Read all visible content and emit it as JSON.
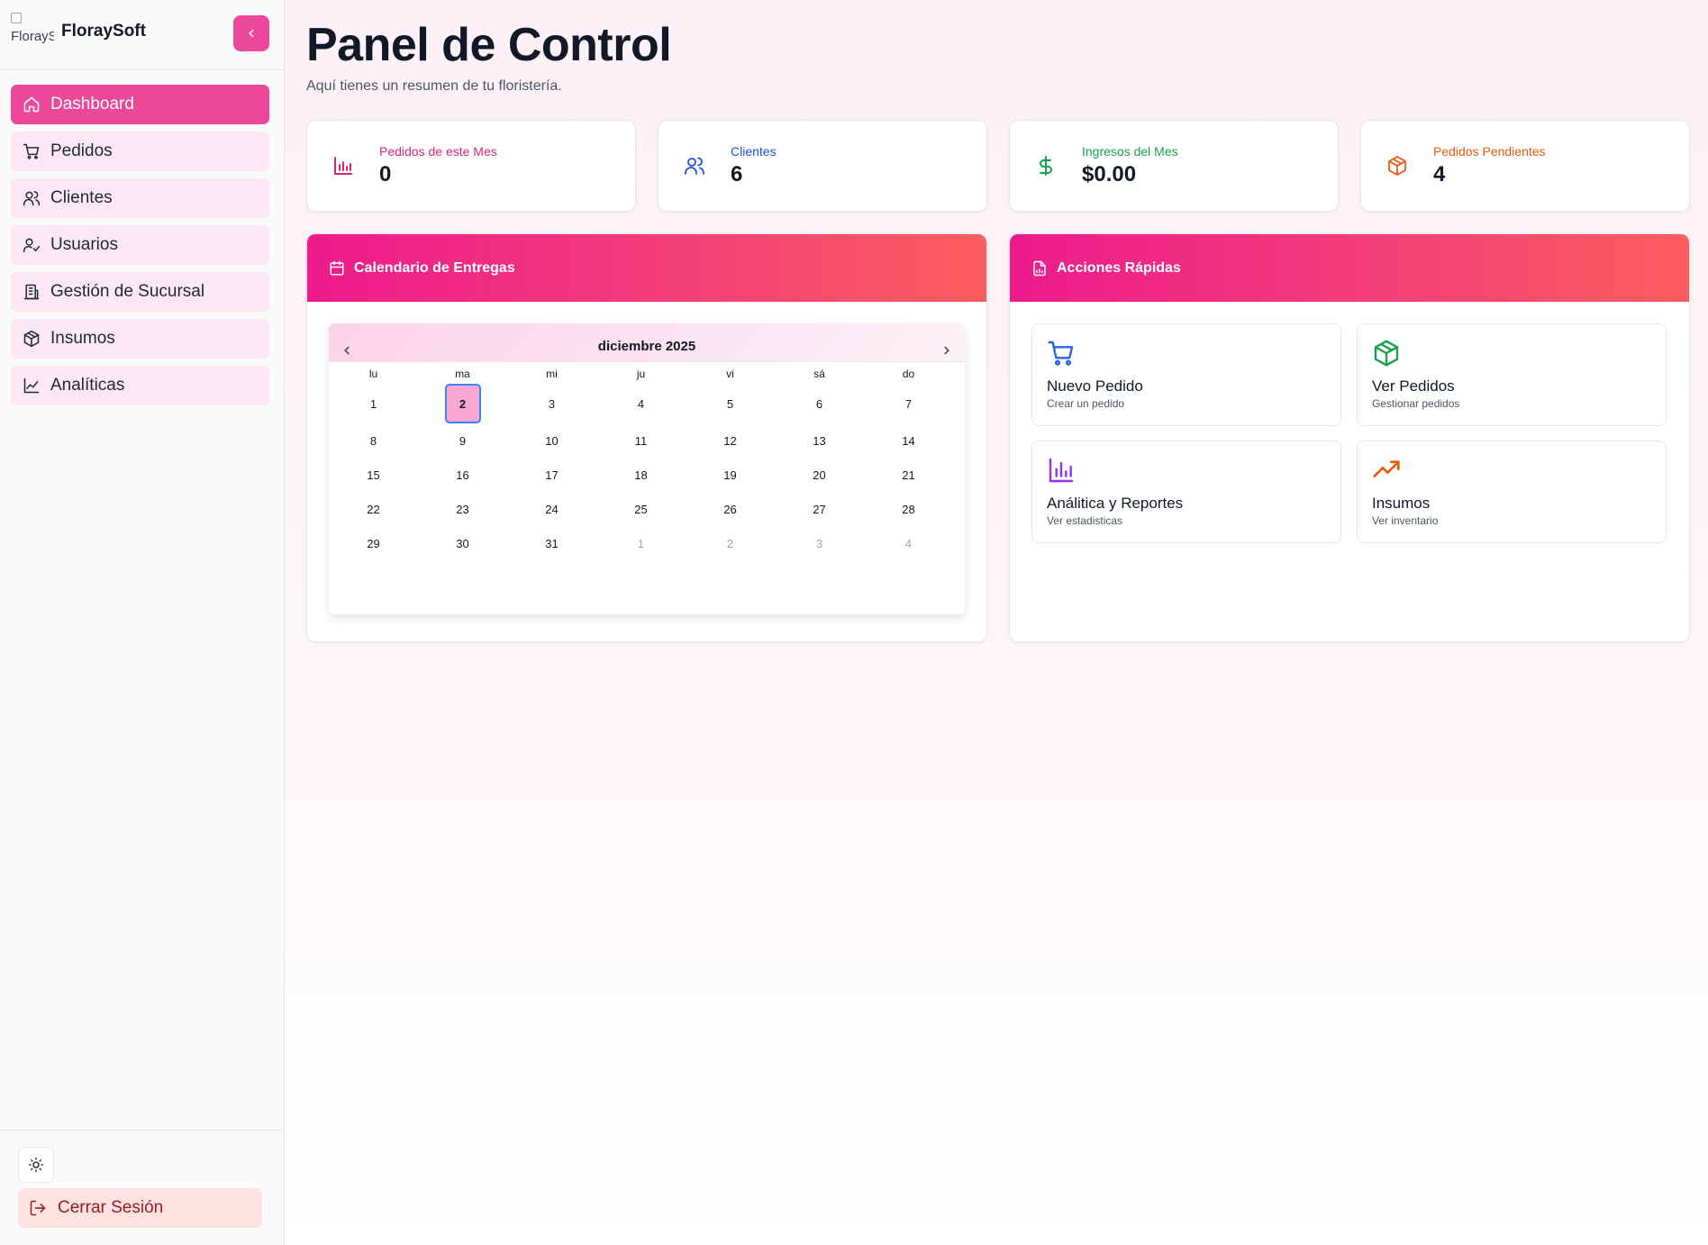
{
  "brand": {
    "logo_alt": "FloraySoft",
    "name": "FloraySoft"
  },
  "sidebar": {
    "items": [
      {
        "label": "Dashboard",
        "icon": "home-icon",
        "active": true
      },
      {
        "label": "Pedidos",
        "icon": "cart-icon"
      },
      {
        "label": "Clientes",
        "icon": "users-icon"
      },
      {
        "label": "Usuarios",
        "icon": "user-check-icon"
      },
      {
        "label": "Gestión de Sucursal",
        "icon": "building-icon"
      },
      {
        "label": "Insumos",
        "icon": "package-icon"
      },
      {
        "label": "Analíticas",
        "icon": "line-chart-icon"
      }
    ],
    "logout_label": "Cerrar Sesión"
  },
  "header": {
    "title": "Panel de Control",
    "subtitle": "Aquí tienes un resumen de tu floristería."
  },
  "stats": [
    {
      "label": "Pedidos de este Mes",
      "value": "0",
      "color": "#db2777",
      "icon": "bar-chart-icon"
    },
    {
      "label": "Clientes",
      "value": "6",
      "color": "#1d4ed8",
      "icon": "users-icon"
    },
    {
      "label": "Ingresos del Mes",
      "value": "$0.00",
      "color": "#16a34a",
      "icon": "dollar-icon"
    },
    {
      "label": "Pedidos Pendientes",
      "value": "4",
      "color": "#ea580c",
      "icon": "package-icon"
    }
  ],
  "calendar": {
    "title": "Calendario de Entregas",
    "month_label": "diciembre 2025",
    "weekdays": [
      "lu",
      "ma",
      "mi",
      "ju",
      "vi",
      "sá",
      "do"
    ],
    "weeks": [
      [
        "1",
        "2",
        "3",
        "4",
        "5",
        "6",
        "7"
      ],
      [
        "8",
        "9",
        "10",
        "11",
        "12",
        "13",
        "14"
      ],
      [
        "15",
        "16",
        "17",
        "18",
        "19",
        "20",
        "21"
      ],
      [
        "22",
        "23",
        "24",
        "25",
        "26",
        "27",
        "28"
      ],
      [
        "29",
        "30",
        "31",
        "1",
        "2",
        "3",
        "4"
      ]
    ],
    "selected_day": "2"
  },
  "quick_actions": {
    "title": "Acciones Rápidas",
    "items": [
      {
        "title": "Nuevo Pedido",
        "desc": "Crear un pedido",
        "color": "#2563eb",
        "icon": "cart-icon"
      },
      {
        "title": "Ver Pedidos",
        "desc": "Gestionar pedidos",
        "color": "#16a34a",
        "icon": "package-icon"
      },
      {
        "title": "Análitica y Reportes",
        "desc": "Ver estadisticas",
        "color": "#9333ea",
        "icon": "bar-chart-icon"
      },
      {
        "title": "Insumos",
        "desc": "Ver inventario",
        "color": "#ea580c",
        "icon": "trending-up-icon"
      }
    ]
  },
  "colors": {
    "accent": "#ec4899",
    "accent_soft": "#fce7f3"
  }
}
